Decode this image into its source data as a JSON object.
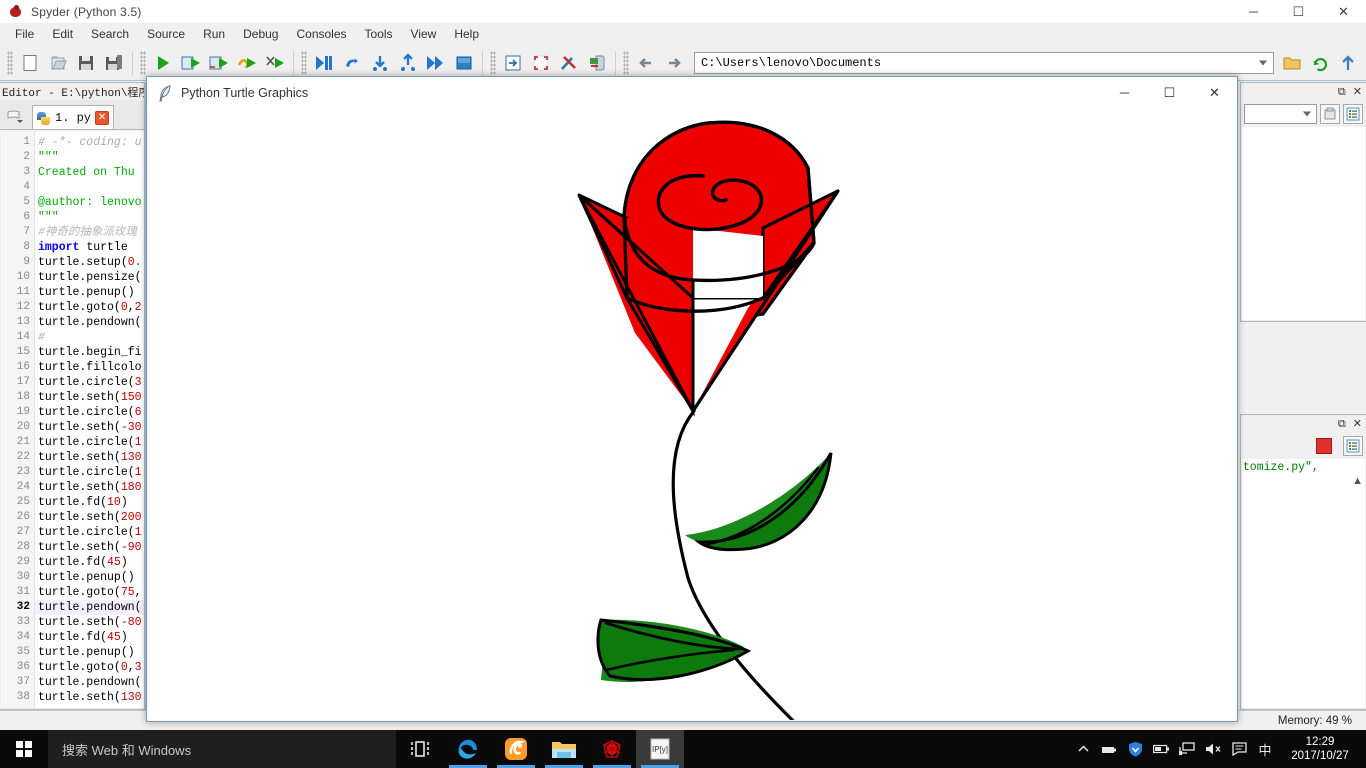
{
  "app": {
    "title": "Spyder (Python 3.5)",
    "icon": "spyder-icon",
    "window_buttons": {
      "minimize": "─",
      "maximize": "☐",
      "close": "✕"
    }
  },
  "menubar": {
    "items": [
      "File",
      "Edit",
      "Search",
      "Source",
      "Run",
      "Debug",
      "Consoles",
      "Tools",
      "View",
      "Help"
    ]
  },
  "toolbar": {
    "path_value": "C:\\Users\\lenovo\\Documents",
    "buttons": [
      {
        "name": "new-file-button",
        "icon": "new-file-icon"
      },
      {
        "name": "open-file-button",
        "icon": "open-folder-icon"
      },
      {
        "name": "save-file-button",
        "icon": "floppy-disk-icon"
      },
      {
        "name": "save-all-button",
        "icon": "save-all-icon"
      },
      {
        "name": "run-file-button",
        "icon": "run-play-icon"
      },
      {
        "name": "run-cell-button",
        "icon": "run-cell-icon"
      },
      {
        "name": "run-cell-advance-button",
        "icon": "run-cell-advance-icon"
      },
      {
        "name": "run-selection-button",
        "icon": "run-selection-icon"
      },
      {
        "name": "configure-run-button",
        "icon": "configure-run-icon"
      },
      {
        "name": "debug-file-button",
        "icon": "debug-icon"
      },
      {
        "name": "debug-continue-button",
        "icon": "debug-continue-icon"
      },
      {
        "name": "debug-step-over-button",
        "icon": "debug-step-over-icon"
      },
      {
        "name": "debug-step-into-button",
        "icon": "debug-step-into-icon"
      },
      {
        "name": "debug-step-return-button",
        "icon": "debug-step-return-icon"
      },
      {
        "name": "debug-stop-button",
        "icon": "debug-stop-icon"
      },
      {
        "name": "maximize-pane-button",
        "icon": "maximize-pane-icon"
      },
      {
        "name": "fullscreen-button",
        "icon": "fullscreen-icon"
      },
      {
        "name": "preferences-button",
        "icon": "tools-icon"
      },
      {
        "name": "python-path-manager-button",
        "icon": "python-path-icon"
      },
      {
        "name": "back-button",
        "icon": "arrow-left-icon"
      },
      {
        "name": "forward-button",
        "icon": "arrow-right-icon"
      },
      {
        "name": "open-last-closed-button",
        "icon": "folder-icon"
      },
      {
        "name": "refresh-button",
        "icon": "refresh-icon"
      },
      {
        "name": "parent-dir-button",
        "icon": "arrow-up-icon"
      }
    ]
  },
  "editor": {
    "dock_title": "Editor - E:\\python\\程序\\",
    "tab": {
      "label": "1. py",
      "icon": "python-file-icon",
      "close": "✕"
    },
    "current_line": 32,
    "lines": [
      {
        "n": 1,
        "tokens": [
          {
            "t": "# -*- coding: u",
            "c": "c-com"
          }
        ]
      },
      {
        "n": 2,
        "tokens": [
          {
            "t": "\"\"\"",
            "c": "c-str"
          }
        ]
      },
      {
        "n": 3,
        "tokens": [
          {
            "t": "Created on Thu ",
            "c": "c-str"
          }
        ]
      },
      {
        "n": 4,
        "tokens": [
          {
            "t": "",
            "c": ""
          }
        ]
      },
      {
        "n": 5,
        "tokens": [
          {
            "t": "@author: lenovo",
            "c": "c-str"
          }
        ]
      },
      {
        "n": 6,
        "tokens": [
          {
            "t": "\"\"\"",
            "c": "c-str"
          }
        ]
      },
      {
        "n": 7,
        "tokens": [
          {
            "t": "#神奇的抽象派玫瑰",
            "c": "c-cjk"
          }
        ]
      },
      {
        "n": 8,
        "tokens": [
          {
            "t": "import",
            "c": "c-kw"
          },
          {
            "t": " turtle",
            "c": ""
          }
        ]
      },
      {
        "n": 9,
        "tokens": [
          {
            "t": "turtle.setup(",
            "c": ""
          },
          {
            "t": "0.",
            "c": "c-num"
          }
        ]
      },
      {
        "n": 10,
        "tokens": [
          {
            "t": "turtle.pensize(",
            "c": ""
          }
        ]
      },
      {
        "n": 11,
        "tokens": [
          {
            "t": "turtle.penup()",
            "c": ""
          }
        ]
      },
      {
        "n": 12,
        "tokens": [
          {
            "t": "turtle.goto(",
            "c": ""
          },
          {
            "t": "0",
            "c": "c-num"
          },
          {
            "t": ",",
            "c": ""
          },
          {
            "t": "2",
            "c": "c-num"
          }
        ]
      },
      {
        "n": 13,
        "tokens": [
          {
            "t": "turtle.pendown(",
            "c": ""
          }
        ]
      },
      {
        "n": 14,
        "tokens": [
          {
            "t": "#",
            "c": "c-com"
          }
        ]
      },
      {
        "n": 15,
        "tokens": [
          {
            "t": "turtle.begin_fi",
            "c": ""
          }
        ]
      },
      {
        "n": 16,
        "tokens": [
          {
            "t": "turtle.fillcolo",
            "c": ""
          }
        ]
      },
      {
        "n": 17,
        "tokens": [
          {
            "t": "turtle.circle(",
            "c": ""
          },
          {
            "t": "3",
            "c": "c-num"
          }
        ]
      },
      {
        "n": 18,
        "tokens": [
          {
            "t": "turtle.seth(",
            "c": ""
          },
          {
            "t": "150",
            "c": "c-num"
          }
        ]
      },
      {
        "n": 19,
        "tokens": [
          {
            "t": "turtle.circle(",
            "c": ""
          },
          {
            "t": "6",
            "c": "c-num"
          }
        ]
      },
      {
        "n": 20,
        "tokens": [
          {
            "t": "turtle.seth(",
            "c": ""
          },
          {
            "t": "-30",
            "c": "c-num"
          }
        ]
      },
      {
        "n": 21,
        "tokens": [
          {
            "t": "turtle.circle(",
            "c": ""
          },
          {
            "t": "1",
            "c": "c-num"
          }
        ]
      },
      {
        "n": 22,
        "tokens": [
          {
            "t": "turtle.seth(",
            "c": ""
          },
          {
            "t": "130",
            "c": "c-num"
          }
        ]
      },
      {
        "n": 23,
        "tokens": [
          {
            "t": "turtle.circle(",
            "c": ""
          },
          {
            "t": "1",
            "c": "c-num"
          }
        ]
      },
      {
        "n": 24,
        "tokens": [
          {
            "t": "turtle.seth(",
            "c": ""
          },
          {
            "t": "180",
            "c": "c-num"
          }
        ]
      },
      {
        "n": 25,
        "tokens": [
          {
            "t": "turtle.fd(",
            "c": ""
          },
          {
            "t": "10",
            "c": "c-num"
          },
          {
            "t": ")",
            "c": ""
          }
        ]
      },
      {
        "n": 26,
        "tokens": [
          {
            "t": "turtle.seth(",
            "c": ""
          },
          {
            "t": "200",
            "c": "c-num"
          }
        ]
      },
      {
        "n": 27,
        "tokens": [
          {
            "t": "turtle.circle(",
            "c": ""
          },
          {
            "t": "1",
            "c": "c-num"
          }
        ]
      },
      {
        "n": 28,
        "tokens": [
          {
            "t": "turtle.seth(",
            "c": ""
          },
          {
            "t": "-90",
            "c": "c-num"
          }
        ]
      },
      {
        "n": 29,
        "tokens": [
          {
            "t": "turtle.fd(",
            "c": ""
          },
          {
            "t": "45",
            "c": "c-num"
          },
          {
            "t": ")",
            "c": ""
          }
        ]
      },
      {
        "n": 30,
        "tokens": [
          {
            "t": "turtle.penup()",
            "c": ""
          }
        ]
      },
      {
        "n": 31,
        "tokens": [
          {
            "t": "turtle.goto(",
            "c": ""
          },
          {
            "t": "75",
            "c": "c-num"
          },
          {
            "t": ",",
            "c": ""
          }
        ]
      },
      {
        "n": 32,
        "tokens": [
          {
            "t": "turtle.pendown(",
            "c": ""
          }
        ]
      },
      {
        "n": 33,
        "tokens": [
          {
            "t": "turtle.seth(",
            "c": ""
          },
          {
            "t": "-80",
            "c": "c-num"
          }
        ]
      },
      {
        "n": 34,
        "tokens": [
          {
            "t": "turtle.fd(",
            "c": ""
          },
          {
            "t": "45",
            "c": "c-num"
          },
          {
            "t": ")",
            "c": ""
          }
        ]
      },
      {
        "n": 35,
        "tokens": [
          {
            "t": "turtle.penup()",
            "c": ""
          }
        ]
      },
      {
        "n": 36,
        "tokens": [
          {
            "t": "turtle.goto(",
            "c": ""
          },
          {
            "t": "0",
            "c": "c-num"
          },
          {
            "t": ",",
            "c": ""
          },
          {
            "t": "3",
            "c": "c-num"
          }
        ]
      },
      {
        "n": 37,
        "tokens": [
          {
            "t": "turtle.pendown(",
            "c": ""
          }
        ]
      },
      {
        "n": 38,
        "tokens": [
          {
            "t": "turtle.seth(",
            "c": ""
          },
          {
            "t": "130",
            "c": "c-num"
          }
        ]
      }
    ]
  },
  "right_panels": {
    "top": {
      "name": "variable-explorer",
      "float_icon": "restore-icon",
      "close_icon": "✕",
      "combo_value": "",
      "buttons": [
        {
          "name": "import-data-button",
          "icon": "import-data-icon"
        },
        {
          "name": "options-button",
          "icon": "options-list-icon"
        }
      ]
    },
    "bottom": {
      "name": "ipython-console",
      "float_icon": "restore-icon",
      "close_icon": "✕",
      "console_text": "stomize.py\",",
      "buttons": [
        {
          "name": "stop-button",
          "icon": "stop-square-icon"
        },
        {
          "name": "options-button",
          "icon": "options-list-icon"
        }
      ]
    }
  },
  "statusbar": {
    "memory": "Memory: 49 %"
  },
  "turtle_window": {
    "title": "Python Turtle Graphics",
    "icon": "feather-icon",
    "buttons": {
      "minimize": "─",
      "maximize": "☐",
      "close": "✕"
    }
  },
  "drawing": {
    "name": "abstract-rose",
    "colors": {
      "petal": "#ee0000",
      "outline": "#000000",
      "leaf": "#1a8a1a",
      "background": "#ffffff"
    }
  },
  "taskbar": {
    "start": "start-button",
    "search_placeholder": "搜索 Web 和 Windows",
    "tasks": [
      {
        "name": "task-view-button",
        "icon": "task-view-icon"
      },
      {
        "name": "edge-browser-button",
        "icon": "edge-icon"
      },
      {
        "name": "uc-browser-button",
        "icon": "uc-browser-icon"
      },
      {
        "name": "file-explorer-button",
        "icon": "folder-icon"
      },
      {
        "name": "spyder-taskbar-button",
        "icon": "spyder-icon"
      },
      {
        "name": "ipython-taskbar-button",
        "icon": "ipython-icon"
      }
    ],
    "tray": [
      {
        "name": "show-hidden-icons-button",
        "glyph": "∧"
      },
      {
        "name": "battery-saver-icon",
        "glyph": "▬"
      },
      {
        "name": "security-shield-icon",
        "glyph": "▼"
      },
      {
        "name": "battery-icon",
        "glyph": "▭"
      },
      {
        "name": "network-icon",
        "glyph": "⌗"
      },
      {
        "name": "volume-muted-icon",
        "glyph": "🔇"
      },
      {
        "name": "action-center-icon",
        "glyph": "⌨"
      },
      {
        "name": "ime-language-icon",
        "glyph": "中"
      }
    ],
    "clock": {
      "time": "12:29",
      "date": "2017/10/27"
    }
  }
}
